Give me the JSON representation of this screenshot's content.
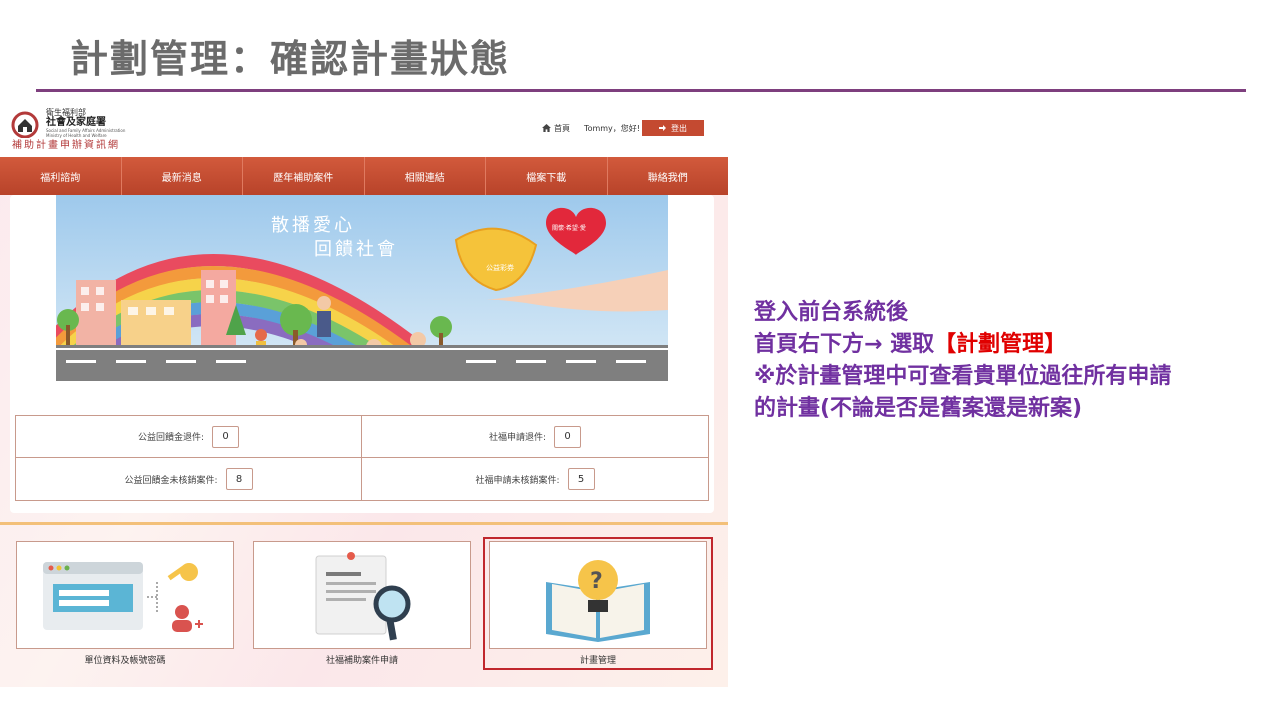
{
  "slide": {
    "title": "計劃管理：確認計畫狀態"
  },
  "site": {
    "ministry": "衛生福利部",
    "agency": "社會及家庭署",
    "agency_en1": "Social and Family Affairs Administration",
    "agency_en2": "Ministry of Health and Welfare",
    "site_name": "補助計畫申辦資訊網"
  },
  "topbar": {
    "home_label": "首頁",
    "greeting": "Tommy，您好!",
    "logout_label": "登出"
  },
  "nav": {
    "items": [
      {
        "label": "福利諮詢"
      },
      {
        "label": "最新消息"
      },
      {
        "label": "歷年補助案件"
      },
      {
        "label": "相關連結"
      },
      {
        "label": "檔案下載"
      },
      {
        "label": "聯絡我們"
      }
    ]
  },
  "banner": {
    "line1": "散播愛心",
    "line2": "回饋社會",
    "heart_text": "關懷·希望·愛",
    "lottery_text": "公益彩券"
  },
  "stats": {
    "items": [
      {
        "label": "公益回饋金退件:",
        "value": "0"
      },
      {
        "label": "社福申請退件:",
        "value": "0"
      },
      {
        "label": "公益回饋金未核銷案件:",
        "value": "8"
      },
      {
        "label": "社福申請未核銷案件:",
        "value": "5"
      }
    ]
  },
  "tiles": {
    "account": "單位資料及帳號密碼",
    "apply": "社福補助案件申請",
    "plan": "計畫管理"
  },
  "explain": {
    "line1": "登入前台系統後",
    "line2_pre": "首頁右下方→ 選取",
    "line2_hl": "【計劃管理】",
    "line3": "※於計畫管理中可查看貴單位過往所有申請",
    "line4": "的計畫(不論是否是舊案還是新案)"
  },
  "colors": {
    "accent_purple": "#7030a0",
    "nav_red": "#c44a31",
    "highlight_red": "#c0272d"
  }
}
